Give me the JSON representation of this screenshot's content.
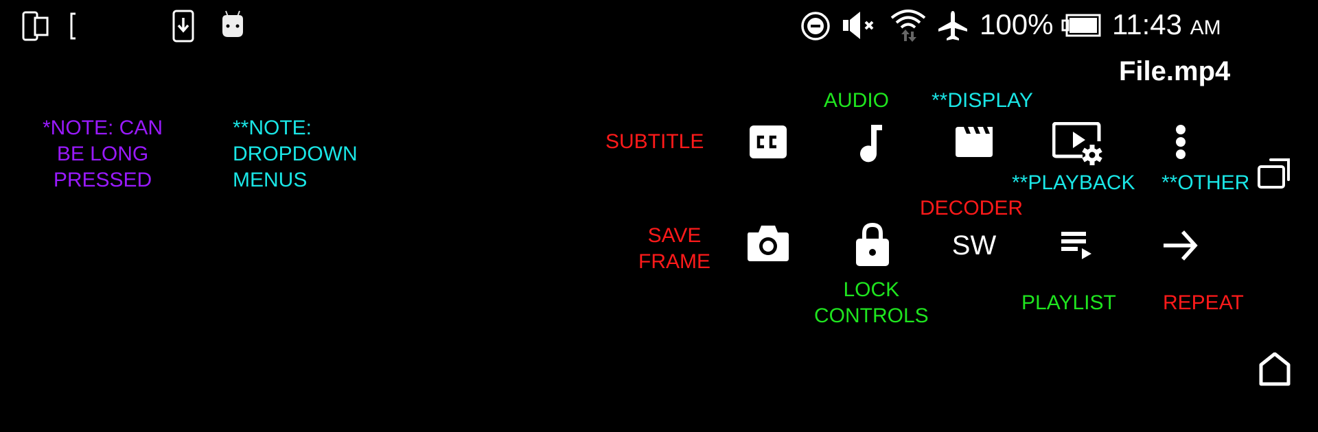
{
  "status_bar": {
    "left_icons": [
      "multi-device-icon",
      "bracket-icon",
      "download-icon",
      "android-icon"
    ],
    "right_icons": [
      "do-not-disturb-icon",
      "mute-icon",
      "wifi-data-icon",
      "airplane-mode-icon",
      "battery-icon"
    ],
    "battery_percent": "100%",
    "time": "11:43",
    "ampm": "AM"
  },
  "player": {
    "file_title": "File.mp4",
    "controls": {
      "subtitle": {
        "label": "SUBTITLE",
        "icon": "closed-caption-icon"
      },
      "audio": {
        "label": "AUDIO",
        "icon": "music-note-icon"
      },
      "display": {
        "label": "**DISPLAY",
        "icon": "clapperboard-icon"
      },
      "playback": {
        "label": "**PLAYBACK",
        "icon": "playback-settings-icon"
      },
      "other": {
        "label": "**OTHER",
        "icon": "more-vertical-icon"
      },
      "popup": {
        "icon": "popup-window-icon"
      },
      "save_frame": {
        "label_line1": "SAVE",
        "label_line2": "FRAME",
        "icon": "camera-icon"
      },
      "lock_controls": {
        "label_line1": "LOCK",
        "label_line2": "CONTROLS",
        "icon": "lock-icon"
      },
      "decoder": {
        "label": "DECODER",
        "value": "SW"
      },
      "playlist": {
        "label": "PLAYLIST",
        "icon": "playlist-icon"
      },
      "repeat": {
        "label": "REPEAT",
        "icon": "arrow-right-icon"
      }
    }
  },
  "notes": {
    "long_press": {
      "line1": "*NOTE: CAN",
      "line2": "BE LONG",
      "line3": "PRESSED"
    },
    "dropdown": {
      "line1": "**NOTE:",
      "line2": "DROPDOWN",
      "line3": "MENUS"
    }
  },
  "nav": {
    "home_icon": "home-icon"
  },
  "colors": {
    "background": "#000000",
    "red_label": "#ff1a1a",
    "green_label": "#1fe51f",
    "cyan_label": "#1ae6e6",
    "purple_label": "#9a1aff",
    "icon": "#ffffff"
  }
}
